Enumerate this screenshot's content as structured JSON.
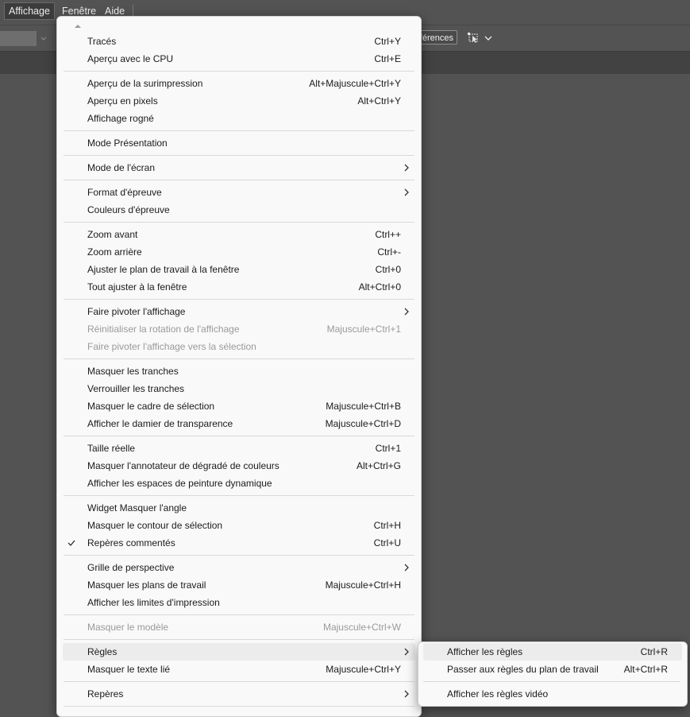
{
  "menubar": {
    "items": [
      "Affichage",
      "Fenêtre",
      "Aide"
    ]
  },
  "controlbar": {
    "preferences_label": "éférences"
  },
  "menu": {
    "items": [
      {
        "label": "Tracés",
        "shortcut": "Ctrl+Y"
      },
      {
        "label": "Aperçu avec le CPU",
        "shortcut": "Ctrl+E"
      },
      {
        "label": "Aperçu de la surimpression",
        "shortcut": "Alt+Majuscule+Ctrl+Y"
      },
      {
        "label": "Aperçu en pixels",
        "shortcut": "Alt+Ctrl+Y"
      },
      {
        "label": "Affichage rogné",
        "shortcut": ""
      },
      {
        "label": "Mode Présentation",
        "shortcut": ""
      },
      {
        "label": "Mode de l'écran",
        "shortcut": ""
      },
      {
        "label": "Format d'épreuve",
        "shortcut": ""
      },
      {
        "label": "Couleurs d'épreuve",
        "shortcut": ""
      },
      {
        "label": "Zoom avant",
        "shortcut": "Ctrl++"
      },
      {
        "label": "Zoom arrière",
        "shortcut": "Ctrl+-"
      },
      {
        "label": "Ajuster le plan de travail à la fenêtre",
        "shortcut": "Ctrl+0"
      },
      {
        "label": "Tout ajuster à la fenêtre",
        "shortcut": "Alt+Ctrl+0"
      },
      {
        "label": "Faire pivoter l'affichage",
        "shortcut": ""
      },
      {
        "label": "Réinitialiser la rotation de l'affichage",
        "shortcut": "Majuscule+Ctrl+1"
      },
      {
        "label": "Faire pivoter l'affichage vers la sélection",
        "shortcut": ""
      },
      {
        "label": "Masquer les tranches",
        "shortcut": ""
      },
      {
        "label": "Verrouiller les tranches",
        "shortcut": ""
      },
      {
        "label": "Masquer le cadre de sélection",
        "shortcut": "Majuscule+Ctrl+B"
      },
      {
        "label": "Afficher le damier de transparence",
        "shortcut": "Majuscule+Ctrl+D"
      },
      {
        "label": "Taille réelle",
        "shortcut": "Ctrl+1"
      },
      {
        "label": "Masquer l'annotateur de dégradé de couleurs",
        "shortcut": "Alt+Ctrl+G"
      },
      {
        "label": "Afficher les espaces de peinture dynamique",
        "shortcut": ""
      },
      {
        "label": "Widget Masquer l'angle",
        "shortcut": ""
      },
      {
        "label": "Masquer le contour de sélection",
        "shortcut": "Ctrl+H"
      },
      {
        "label": "Repères commentés",
        "shortcut": "Ctrl+U"
      },
      {
        "label": "Grille de perspective",
        "shortcut": ""
      },
      {
        "label": "Masquer les plans de travail",
        "shortcut": "Majuscule+Ctrl+H"
      },
      {
        "label": "Afficher les limites d'impression",
        "shortcut": ""
      },
      {
        "label": "Masquer le modèle",
        "shortcut": "Majuscule+Ctrl+W"
      },
      {
        "label": "Règles",
        "shortcut": ""
      },
      {
        "label": "Masquer le texte lié",
        "shortcut": "Majuscule+Ctrl+Y"
      },
      {
        "label": "Repères",
        "shortcut": ""
      }
    ]
  },
  "submenu": {
    "items": [
      {
        "label": "Afficher les règles",
        "shortcut": "Ctrl+R"
      },
      {
        "label": "Passer aux règles du plan de travail",
        "shortcut": "Alt+Ctrl+R"
      },
      {
        "label": "Afficher les règles vidéo",
        "shortcut": ""
      }
    ]
  }
}
